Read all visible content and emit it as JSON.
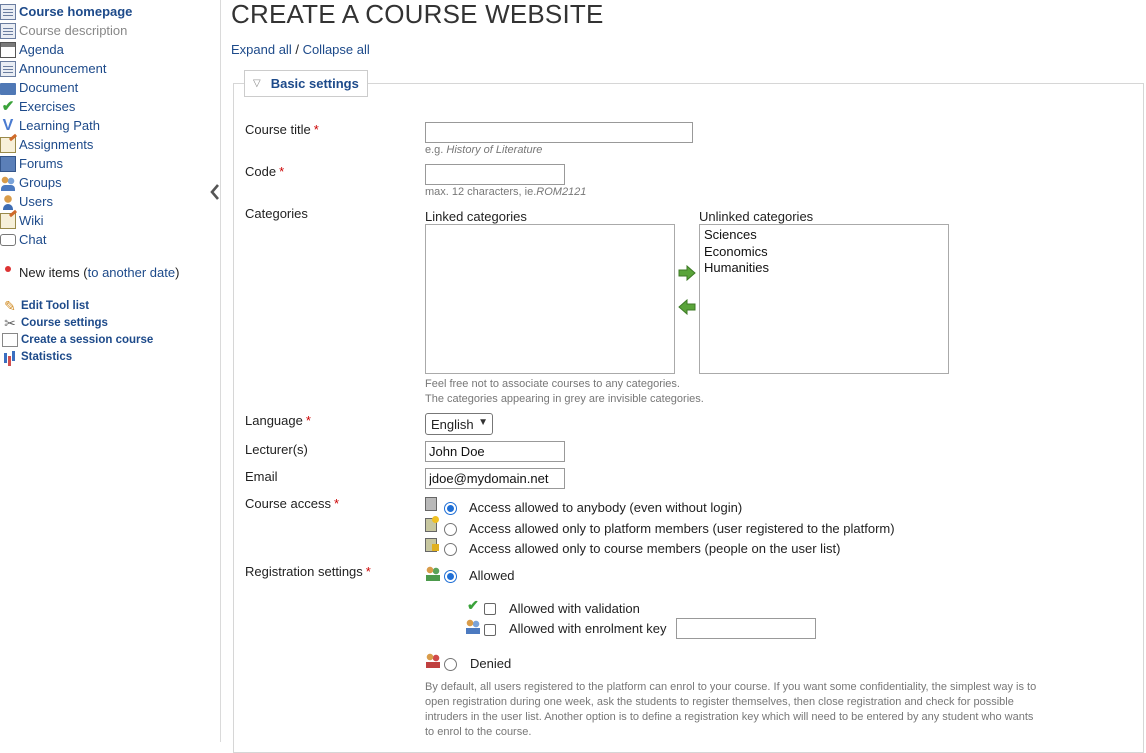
{
  "sidebar": {
    "tools": [
      {
        "label": "Course homepage",
        "icon": "course-homepage-icon",
        "style": "bold"
      },
      {
        "label": "Course description",
        "icon": "course-description-icon",
        "style": "grey"
      },
      {
        "label": "Agenda",
        "icon": "agenda-icon",
        "style": "normal"
      },
      {
        "label": "Announcement",
        "icon": "announcement-icon",
        "style": "normal"
      },
      {
        "label": "Document",
        "icon": "document-icon",
        "style": "normal"
      },
      {
        "label": "Exercises",
        "icon": "exercises-icon",
        "style": "normal"
      },
      {
        "label": "Learning Path",
        "icon": "learning-path-icon",
        "style": "normal"
      },
      {
        "label": "Assignments",
        "icon": "assignments-icon",
        "style": "normal"
      },
      {
        "label": "Forums",
        "icon": "forums-icon",
        "style": "normal"
      },
      {
        "label": "Groups",
        "icon": "groups-icon",
        "style": "normal"
      },
      {
        "label": "Users",
        "icon": "users-icon",
        "style": "normal"
      },
      {
        "label": "Wiki",
        "icon": "wiki-icon",
        "style": "normal"
      },
      {
        "label": "Chat",
        "icon": "chat-icon",
        "style": "normal"
      }
    ],
    "new_items": {
      "label": "New items (",
      "link": "to another date",
      "close": ")"
    },
    "admin": [
      {
        "label": "Edit Tool list",
        "icon": "pencil-icon"
      },
      {
        "label": "Course settings",
        "icon": "tools-icon"
      },
      {
        "label": "Create a session course",
        "icon": "session-icon"
      },
      {
        "label": "Statistics",
        "icon": "statistics-icon"
      }
    ]
  },
  "main": {
    "title": "CREATE A COURSE WEBSITE",
    "expand_all": "Expand all",
    "separator": " / ",
    "collapse_all": "Collapse all",
    "section": "Basic settings",
    "course_title": {
      "label": "Course title",
      "value": "",
      "hint_prefix": "e.g. ",
      "hint_example": "History of Literature"
    },
    "code": {
      "label": "Code",
      "value": "",
      "hint_prefix": "max. 12 characters, ie.",
      "hint_example": "ROM2121"
    },
    "categories": {
      "label": "Categories",
      "linked_label": "Linked categories",
      "unlinked_label": "Unlinked categories",
      "linked": [],
      "unlinked": [
        "Sciences",
        "Economics",
        "Humanities"
      ],
      "hint1": "Feel free not to associate courses to any categories.",
      "hint2": "The categories appearing in grey are invisible categories."
    },
    "language": {
      "label": "Language",
      "selected": "English"
    },
    "lecturers": {
      "label": "Lecturer(s)",
      "value": "John Doe"
    },
    "email": {
      "label": "Email",
      "value": "jdoe@mydomain.net"
    },
    "course_access": {
      "label": "Course access",
      "options": [
        "Access allowed to anybody (even without login)",
        "Access allowed only to platform members (user registered to the platform)",
        "Access allowed only to course members (people on the user list)"
      ],
      "selected": 0
    },
    "registration": {
      "label": "Registration settings",
      "allowed": "Allowed",
      "validation": "Allowed with validation",
      "enrolment_key": "Allowed with enrolment key",
      "enrolment_key_value": "",
      "denied": "Denied",
      "selected": "allowed",
      "help": "By default, all users registered to the platform can enrol to your course. If you want some confidentiality, the simplest way is to open registration during one week, ask the students to register themselves, then close registration and check for possible intruders in the user list. Another option is to define a registration key which will need to be entered by any student who wants to enrol to the course."
    },
    "required_mark": "*"
  },
  "colors": {
    "link": "#1d4a8a",
    "required": "#cc0000",
    "radio_selected": "#1f6fd6",
    "arrow_green": "#5aa43a"
  }
}
